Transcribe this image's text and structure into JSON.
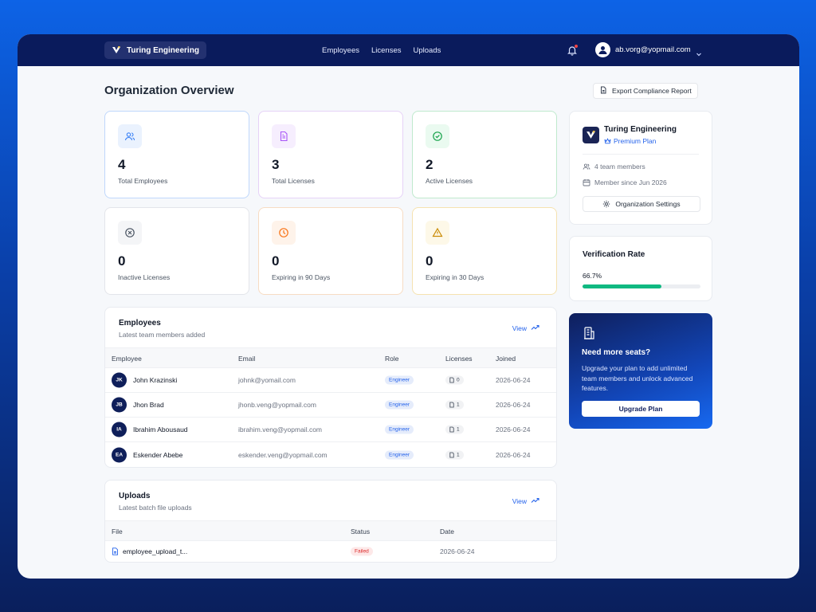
{
  "header": {
    "brand": "Turing Engineering",
    "nav": [
      "Employees",
      "Licenses",
      "Uploads"
    ],
    "user_email": "ab.vorg@yopmail.com"
  },
  "page": {
    "title": "Organization Overview",
    "export_label": "Export Compliance Report"
  },
  "stats": [
    {
      "value": "4",
      "label": "Total Employees",
      "icon": "users-icon",
      "color": "#3b82f6"
    },
    {
      "value": "3",
      "label": "Total Licenses",
      "icon": "file-text-icon",
      "color": "#a855f7"
    },
    {
      "value": "2",
      "label": "Active Licenses",
      "icon": "check-circle-icon",
      "color": "#16a34a"
    },
    {
      "value": "0",
      "label": "Inactive Licenses",
      "icon": "x-circle-icon",
      "color": "#6b7280"
    },
    {
      "value": "0",
      "label": "Expiring in 90 Days",
      "icon": "clock-icon",
      "color": "#f97316"
    },
    {
      "value": "0",
      "label": "Expiring in 30 Days",
      "icon": "alert-triangle-icon",
      "color": "#eab308"
    }
  ],
  "employees": {
    "title": "Employees",
    "subtitle": "Latest team members added",
    "view_label": "View",
    "columns": [
      "Employee",
      "Email",
      "Role",
      "Licenses",
      "Joined"
    ],
    "rows": [
      {
        "initials": "JK",
        "name": "John Krazinski",
        "email": "johnk@yomail.com",
        "role": "Engineer",
        "licenses": "0",
        "joined": "2026-06-24"
      },
      {
        "initials": "JB",
        "name": "Jhon Brad",
        "email": "jhonb.veng@yopmail.com",
        "role": "Engineer",
        "licenses": "1",
        "joined": "2026-06-24"
      },
      {
        "initials": "IA",
        "name": "Ibrahim Abousaud",
        "email": "ibrahim.veng@yopmail.com",
        "role": "Engineer",
        "licenses": "1",
        "joined": "2026-06-24"
      },
      {
        "initials": "EA",
        "name": "Eskender Abebe",
        "email": "eskender.veng@yopmail.com",
        "role": "Engineer",
        "licenses": "1",
        "joined": "2026-06-24"
      }
    ]
  },
  "uploads": {
    "title": "Uploads",
    "subtitle": "Latest batch file uploads",
    "view_label": "View",
    "columns": [
      "File",
      "Status",
      "Date"
    ],
    "rows": [
      {
        "file": "employee_upload_t...",
        "status": "Failed",
        "date": "2026-06-24"
      }
    ]
  },
  "org": {
    "name": "Turing Engineering",
    "plan": "Premium Plan",
    "members": "4 team members",
    "since": "Member since Jun 2026",
    "settings_label": "Organization Settings"
  },
  "verification": {
    "title": "Verification Rate",
    "value_text": "66.7%",
    "fraction": 0.667
  },
  "upgrade": {
    "title": "Need more seats?",
    "text": "Upgrade your plan to add unlimited team members and unlock advanced features.",
    "button": "Upgrade Plan"
  }
}
